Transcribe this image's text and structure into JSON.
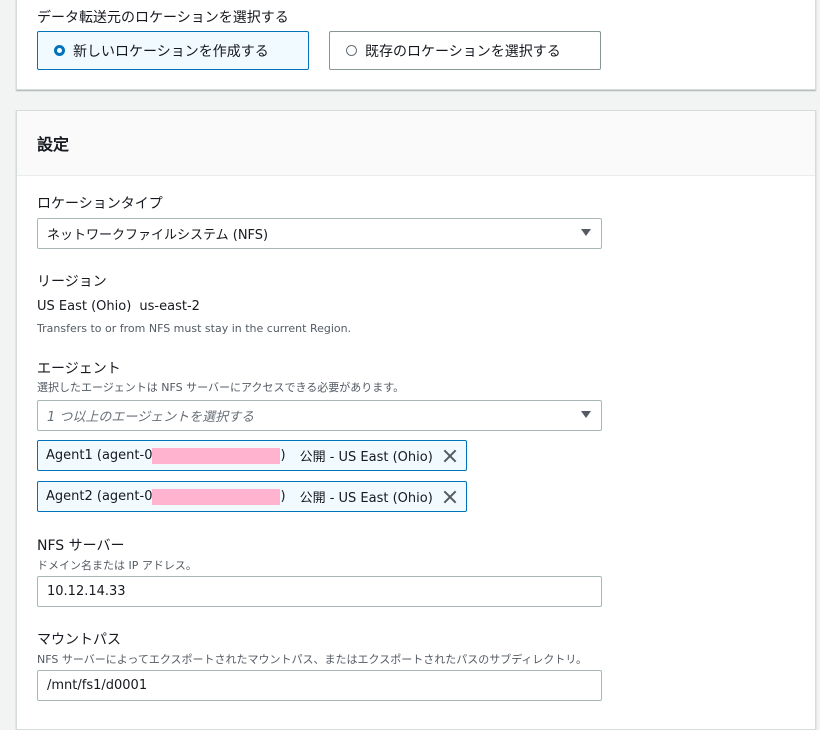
{
  "source_location": {
    "label": "データ転送元のロケーションを選択する",
    "options": [
      {
        "label": "新しいロケーションを作成する",
        "selected": true
      },
      {
        "label": "既存のロケーションを選択する",
        "selected": false
      }
    ]
  },
  "settings": {
    "title": "設定",
    "location_type": {
      "label": "ロケーションタイプ",
      "value": "ネットワークファイルシステム (NFS)"
    },
    "region": {
      "label": "リージョン",
      "value": "US East (Ohio)",
      "code": "us-east-2",
      "note": "Transfers to or from NFS must stay in the current Region."
    },
    "agents": {
      "label": "エージェント",
      "description": "選択したエージェントは NFS サーバーにアクセスできる必要があります。",
      "placeholder": "1 つ以上のエージェントを選択する",
      "selected": [
        {
          "prefix": "Agent1 (agent-0",
          "suffix": ")",
          "status": "公開 - US East (Ohio)"
        },
        {
          "prefix": "Agent2 (agent-0",
          "suffix": ")",
          "status": "公開 - US East (Ohio)"
        }
      ]
    },
    "nfs_server": {
      "label": "NFS サーバー",
      "description": "ドメイン名または IP アドレス。",
      "value": "10.12.14.33"
    },
    "mount_path": {
      "label": "マウントパス",
      "description": "NFS サーバーによってエクスポートされたマウントパス、またはエクスポートされたパスのサブディレクトリ。",
      "value": "/mnt/fs1/d0001"
    }
  },
  "colors": {
    "accent": "#0073bb",
    "selected_bg": "#f1faff",
    "redaction": "#ffb3cf"
  },
  "icons": {
    "dropdown": "caret-down-icon",
    "remove": "close-icon",
    "radio": "radio-icon"
  }
}
